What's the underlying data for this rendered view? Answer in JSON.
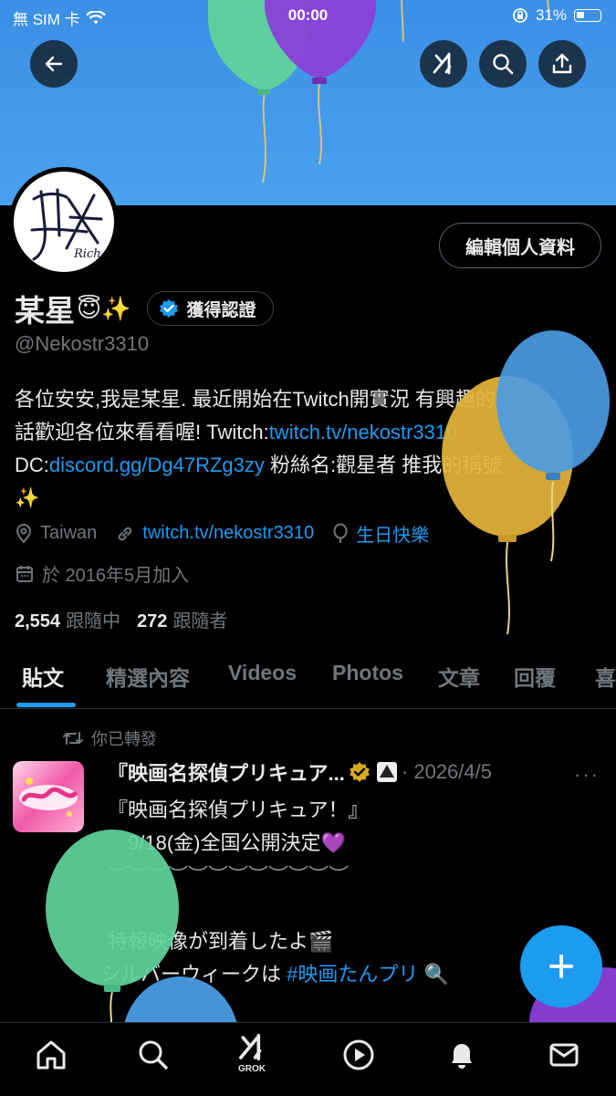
{
  "status_bar": {
    "carrier": "無 SIM 卡",
    "time": "00:00",
    "battery": "31%"
  },
  "header": {
    "back_icon": "arrow-left-icon",
    "grok_icon": "grok-icon",
    "search_icon": "search-icon",
    "share_icon": "share-icon"
  },
  "profile": {
    "edit_button": "編輯個人資料",
    "display_name": "某星",
    "name_emojis": "😇✨",
    "verified_label": "獲得認證",
    "handle": "@Nekostr3310",
    "bio": {
      "line1": "各位安安,我是某星. 最近開始在Twitch開實況 有興趣的",
      "line2_text": "話歡迎各位來看看喔! Twitch:",
      "line2_link": "twitch.tv/nekostr3310",
      "line3_prefix": "DC:",
      "line3_link": "discord.gg/Dg47RZg3zy",
      "line3_text": " 粉絲名:觀星者 推我的稱號",
      "line4": "✨"
    },
    "location": "Taiwan",
    "website": "twitch.tv/nekostr3310",
    "birthday": "生日快樂",
    "joined": "於 2016年5月加入",
    "following_count": "2,554",
    "following_label": "跟隨中",
    "followers_count": "272",
    "followers_label": "跟隨者"
  },
  "tabs": [
    "貼文",
    "精選內容",
    "Videos",
    "Photos",
    "文章",
    "回覆",
    "喜"
  ],
  "tweet": {
    "repost_note": "你已轉發",
    "author": "『映画名探偵プリキュア...",
    "date": "· 2026/4/5",
    "more": "···",
    "lines": [
      "『映画名探偵プリキュア！』",
      "　9/18(金)全国公開決定💜",
      "︶︶︶︶︶︶︶︶︶︶︶︶",
      "",
      "特報映像が到着したよ🎬",
      "シルバーウィークは "
    ],
    "hashtag": "#映画たんプリ",
    "hashtag_suffix": " 🔍"
  },
  "fab_label": "+",
  "bottom_nav": {
    "home_icon": "home-icon",
    "search_icon": "search-icon",
    "grok_label": "GROK",
    "video_icon": "play-icon",
    "notifications_icon": "bell-icon",
    "messages_icon": "mail-icon"
  },
  "colors": {
    "accent": "#1d9bf0",
    "banner": "#4aa1ee",
    "balloon_green": "#5fd39a",
    "balloon_purple": "#8b3fd9",
    "balloon_blue": "#4b9be3",
    "balloon_yellow": "#e3b43a"
  }
}
